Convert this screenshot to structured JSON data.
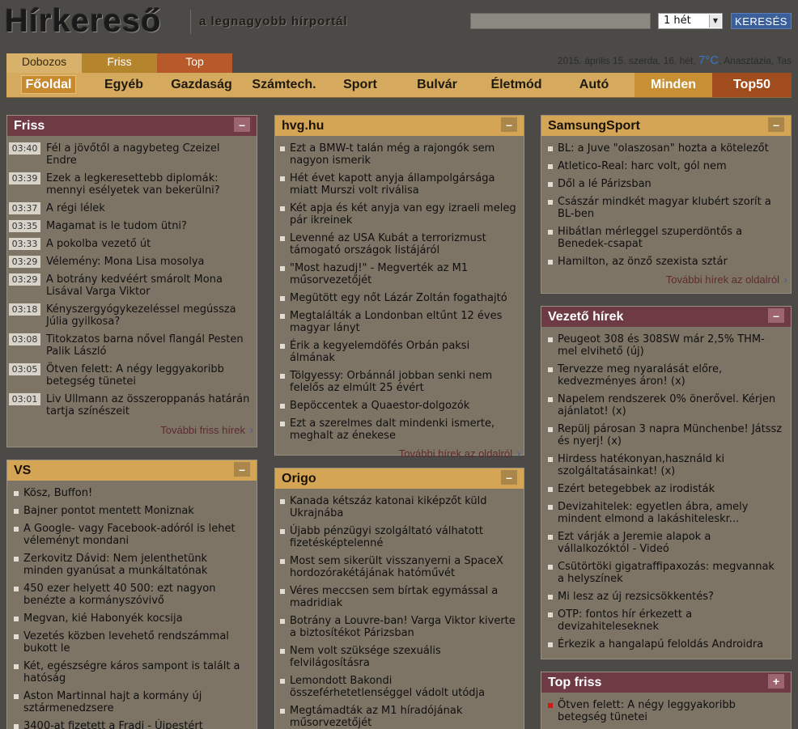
{
  "header": {
    "logo": "Hírkereső",
    "tagline": "a legnagyobb hírportál",
    "search_placeholder": "",
    "period_value": "1 hét",
    "search_button": "KERESÉS"
  },
  "view_tabs": [
    "Dobozos",
    "Friss",
    "Top"
  ],
  "dateline": {
    "date": "2015. április 15. szerda, 16. hét,",
    "temp": "7°C",
    "names": ", Anasztázia, Tas"
  },
  "nav": [
    "Főoldal",
    "Egyéb",
    "Gazdaság",
    "Számtech.",
    "Sport",
    "Bulvár",
    "Életmód",
    "Autó",
    "Minden",
    "Top50"
  ],
  "boxes": {
    "friss": {
      "title": "Friss",
      "toggle": "–",
      "items": [
        {
          "time": "03:40",
          "text": "Fél a jövőtől a nagybeteg Czeizel Endre"
        },
        {
          "time": "03:39",
          "text": "Ezek a legkeresettebb diplomák: mennyi esélyetek van bekerülni?"
        },
        {
          "time": "03:37",
          "text": "A régi lélek"
        },
        {
          "time": "03:35",
          "text": "Magamat is le tudom ütni?"
        },
        {
          "time": "03:33",
          "text": "A pokolba vezető út"
        },
        {
          "time": "03:29",
          "text": "Vélemény: Mona Lisa mosolya"
        },
        {
          "time": "03:29",
          "text": "A botrány kedvéért smárolt Mona Lisával Varga Viktor"
        },
        {
          "time": "03:18",
          "text": "Kényszergyógykezeléssel megússza Júlia gyilkosa?"
        },
        {
          "time": "03:08",
          "text": "Titokzatos barna nővel flangál Pesten Palik László"
        },
        {
          "time": "03:05",
          "text": "Ötven felett: A négy leggyakoribb betegség tünetei"
        },
        {
          "time": "03:01",
          "text": "Liv Ullmann az összeroppanás határán tartja színészeit"
        }
      ],
      "more": "További friss hírek"
    },
    "vs": {
      "title": "VS",
      "toggle": "–",
      "items": [
        "Kösz, Buffon!",
        "Bajner pontot mentett Moniznak",
        "A Google- vagy Facebook-adóról is lehet véleményt mondani",
        "Zerkovitz Dávid: Nem jelenthetünk minden gyanúsat a munkáltatónak",
        "450 ezer helyett 40 500: ezt nagyon benézte a kormányszóvivő",
        "Megvan, kié Habonyék kocsija",
        "Vezetés közben levehető rendszámmal bukott le",
        "Két, egészségre káros sampont is talált a hatóság",
        "Aston Martinnal hajt a kormány új sztármenedzsere",
        "3400-at fizetett a Fradi - Újpestért"
      ]
    },
    "hvg": {
      "title": "hvg.hu",
      "toggle": "–",
      "items": [
        "Ezt a BMW-t talán még a rajongók sem nagyon ismerik",
        "Hét évet kapott anyja állampolgársága miatt Murszi volt riválisa",
        "Két apja és két anyja van egy izraeli meleg pár ikreinek",
        "Levenné az USA Kubát a terrorizmust támogató országok listájáról",
        "\"Most hazudj!\" - Megverték az M1 műsorvezetőjét",
        "Megütött egy nőt Lázár Zoltán fogathajtó",
        "Megtalálták a Londonban eltűnt 12 éves magyar lányt",
        "Érik a kegyelemdöfés Orbán paksi álmának",
        "Tölgyessy: Orbánnál jobban senki nem felelős az elmúlt 25 évért",
        "Bepöccentek a Quaestor-dolgozók",
        "Ezt a szerelmes dalt mindenki ismerte, meghalt az énekese"
      ],
      "more": "További hírek az oldalról"
    },
    "origo": {
      "title": "Origo",
      "toggle": "–",
      "items": [
        "Kanada kétszáz katonai kiképzőt küld Ukrajnába",
        "Újabb pénzügyi szolgáltató válhatott fizetésképtelenné",
        "Most sem sikerült visszanyerni a SpaceX hordozórakétájának hatóművét",
        "Véres meccsen sem bírtak egymással a madridiak",
        "Botrány a Louvre-ban! Varga Viktor kiverte a biztosítékot Párizsban",
        "Nem volt szüksége szexuális felvilágosításra",
        "Lemondott Bakondi összeférhetetlenséggel vádolt utódja",
        "Megtámadták az M1 híradójának műsorvezetőjét"
      ]
    },
    "samsung": {
      "title": "SamsungSport",
      "toggle": "–",
      "items": [
        "BL: a Juve \"olaszosan\" hozta a kötelezőt",
        "Atletico-Real: harc volt, gól nem",
        "Dől a lé Párizsban",
        "Császár mindkét magyar klubért szorít a BL-ben",
        "Hibátlan mérleggel szuperdöntős a Benedek-csapat",
        "Hamilton, az önző szexista sztár"
      ],
      "more": "További hírek az oldalról"
    },
    "vezeto": {
      "title": "Vezető hírek",
      "toggle": "–",
      "items": [
        "Peugeot 308 és 308SW már 2,5% THM-mel elvihető (új)",
        "Tervezze meg nyaralását előre, kedvezményes áron! (x)",
        "Napelem rendszerek 0% önerővel. Kérjen ajánlatot! (x)",
        "Repülj párosan 3 napra Münchenbe! Játssz és nyerj! (x)",
        "Hirdess hatékonyan,használd ki szolgáltatásainkat! (x)",
        "Ezért betegebbek az irodisták",
        "Devizahitelek: egyetlen ábra, amely mindent elmond a lakáshiteleskr...",
        "Ezt várják a Jeremie alapok a vállalkozóktól - Videó",
        "Csütörtöki gigatraffipaxozás: megvannak a helyszínek",
        "Mi lesz az új rezsicsökkentés?",
        "OTP: fontos hír érkezett a devizahiteleseknek",
        "Érkezik a hangalapú feloldás Androidra"
      ]
    },
    "topfriss": {
      "title": "Top friss",
      "toggle": "+",
      "items": [
        "Ötven felett: A négy leggyakoribb betegség tünetei"
      ]
    }
  }
}
